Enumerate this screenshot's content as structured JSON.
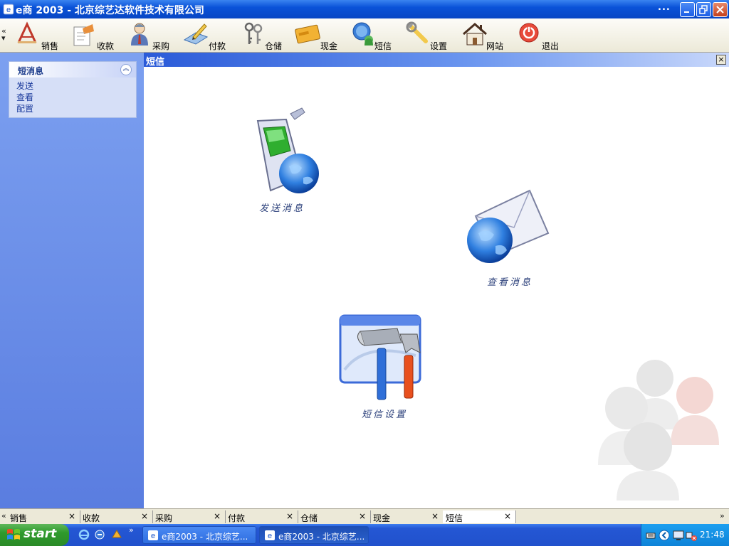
{
  "window": {
    "title": "e商 2003 - 北京综艺达软件技术有限公司",
    "more": "..."
  },
  "toolbar": {
    "items": [
      {
        "label": "销售",
        "icon": "sales-icon"
      },
      {
        "label": "收款",
        "icon": "receipt-icon"
      },
      {
        "label": "采购",
        "icon": "purchase-icon"
      },
      {
        "label": "付款",
        "icon": "payment-icon"
      },
      {
        "label": "仓储",
        "icon": "warehouse-icon"
      },
      {
        "label": "现金",
        "icon": "cash-icon"
      },
      {
        "label": "短信",
        "icon": "sms-icon"
      },
      {
        "label": "设置",
        "icon": "settings-icon"
      },
      {
        "label": "网站",
        "icon": "website-icon"
      },
      {
        "label": "退出",
        "icon": "exit-icon"
      }
    ]
  },
  "sidebar": {
    "group_title": "短消息",
    "links": [
      "发送",
      "查看",
      "配置"
    ]
  },
  "content": {
    "title": "短信",
    "features": [
      {
        "label": "发送消息",
        "icon": "send-message-icon"
      },
      {
        "label": "查看消息",
        "icon": "view-message-icon"
      },
      {
        "label": "短信设置",
        "icon": "sms-settings-icon"
      }
    ]
  },
  "tabs": [
    {
      "label": "销售"
    },
    {
      "label": "收款"
    },
    {
      "label": "采购"
    },
    {
      "label": "付款"
    },
    {
      "label": "仓储"
    },
    {
      "label": "现金"
    },
    {
      "label": "短信"
    }
  ],
  "taskbar": {
    "start_label": "start",
    "buttons": [
      "e商2003 - 北京综艺...",
      "e商2003 - 北京综艺..."
    ],
    "clock": "21:48"
  },
  "colors": {
    "title_bar": "#0a52d8",
    "sidebar": "#6a8ee6",
    "taskbar": "#2457d4",
    "start_button": "#2f9a2c"
  }
}
